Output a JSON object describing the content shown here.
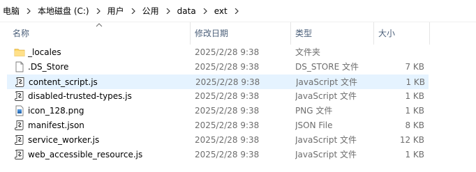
{
  "breadcrumb": [
    "电脑",
    "本地磁盘 (C:)",
    "用户",
    "公用",
    "data",
    "ext"
  ],
  "columns": {
    "name": "名称",
    "modified": "修改日期",
    "type": "类型",
    "size": "大小"
  },
  "files": [
    {
      "name": "_locales",
      "modified": "2025/2/28 9:38",
      "type": "文件夹",
      "size": "",
      "icon": "folder-icon"
    },
    {
      "name": ".DS_Store",
      "modified": "2025/2/28 9:38",
      "type": "DS_STORE 文件",
      "size": "7 KB",
      "icon": "blank-file-icon"
    },
    {
      "name": "content_script.js",
      "modified": "2025/2/28 9:38",
      "type": "JavaScript 文件",
      "size": "1 KB",
      "icon": "script-file-icon"
    },
    {
      "name": "disabled-trusted-types.js",
      "modified": "2025/2/28 9:38",
      "type": "JavaScript 文件",
      "size": "1 KB",
      "icon": "script-file-icon"
    },
    {
      "name": "icon_128.png",
      "modified": "2025/2/28 9:38",
      "type": "PNG 文件",
      "size": "1 KB",
      "icon": "image-file-icon"
    },
    {
      "name": "manifest.json",
      "modified": "2025/2/28 9:38",
      "type": "JSON File",
      "size": "8 KB",
      "icon": "json-file-icon"
    },
    {
      "name": "service_worker.js",
      "modified": "2025/2/28 9:38",
      "type": "JavaScript 文件",
      "size": "12 KB",
      "icon": "script-file-icon"
    },
    {
      "name": "web_accessible_resource.js",
      "modified": "2025/2/28 9:38",
      "type": "JavaScript 文件",
      "size": "1 KB",
      "icon": "script-file-icon"
    }
  ],
  "selected_row": 2,
  "colors": {
    "selection": "#e5f3ff",
    "header_text": "#4c607a",
    "meta_text": "#6d6d6d",
    "folder": "#ffd766"
  }
}
